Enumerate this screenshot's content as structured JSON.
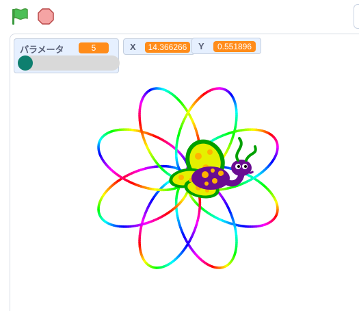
{
  "toolbar": {
    "green_flag_icon": "green-flag-icon",
    "stop_icon": "stop-sign-icon"
  },
  "monitors": {
    "parameter": {
      "label": "パラメータ",
      "value": "5",
      "slider_level": 0.0
    },
    "x": {
      "label": "X",
      "value": "14.366266"
    },
    "y": {
      "label": "Y",
      "value": "0.551896"
    }
  },
  "colors": {
    "accent_orange": "#ff8c1a",
    "monitor_bg": "#e6f0ff",
    "slider_knob": "#0e7f6f",
    "flag_green": "#4cbf56",
    "stop_red": "#ec5959"
  }
}
